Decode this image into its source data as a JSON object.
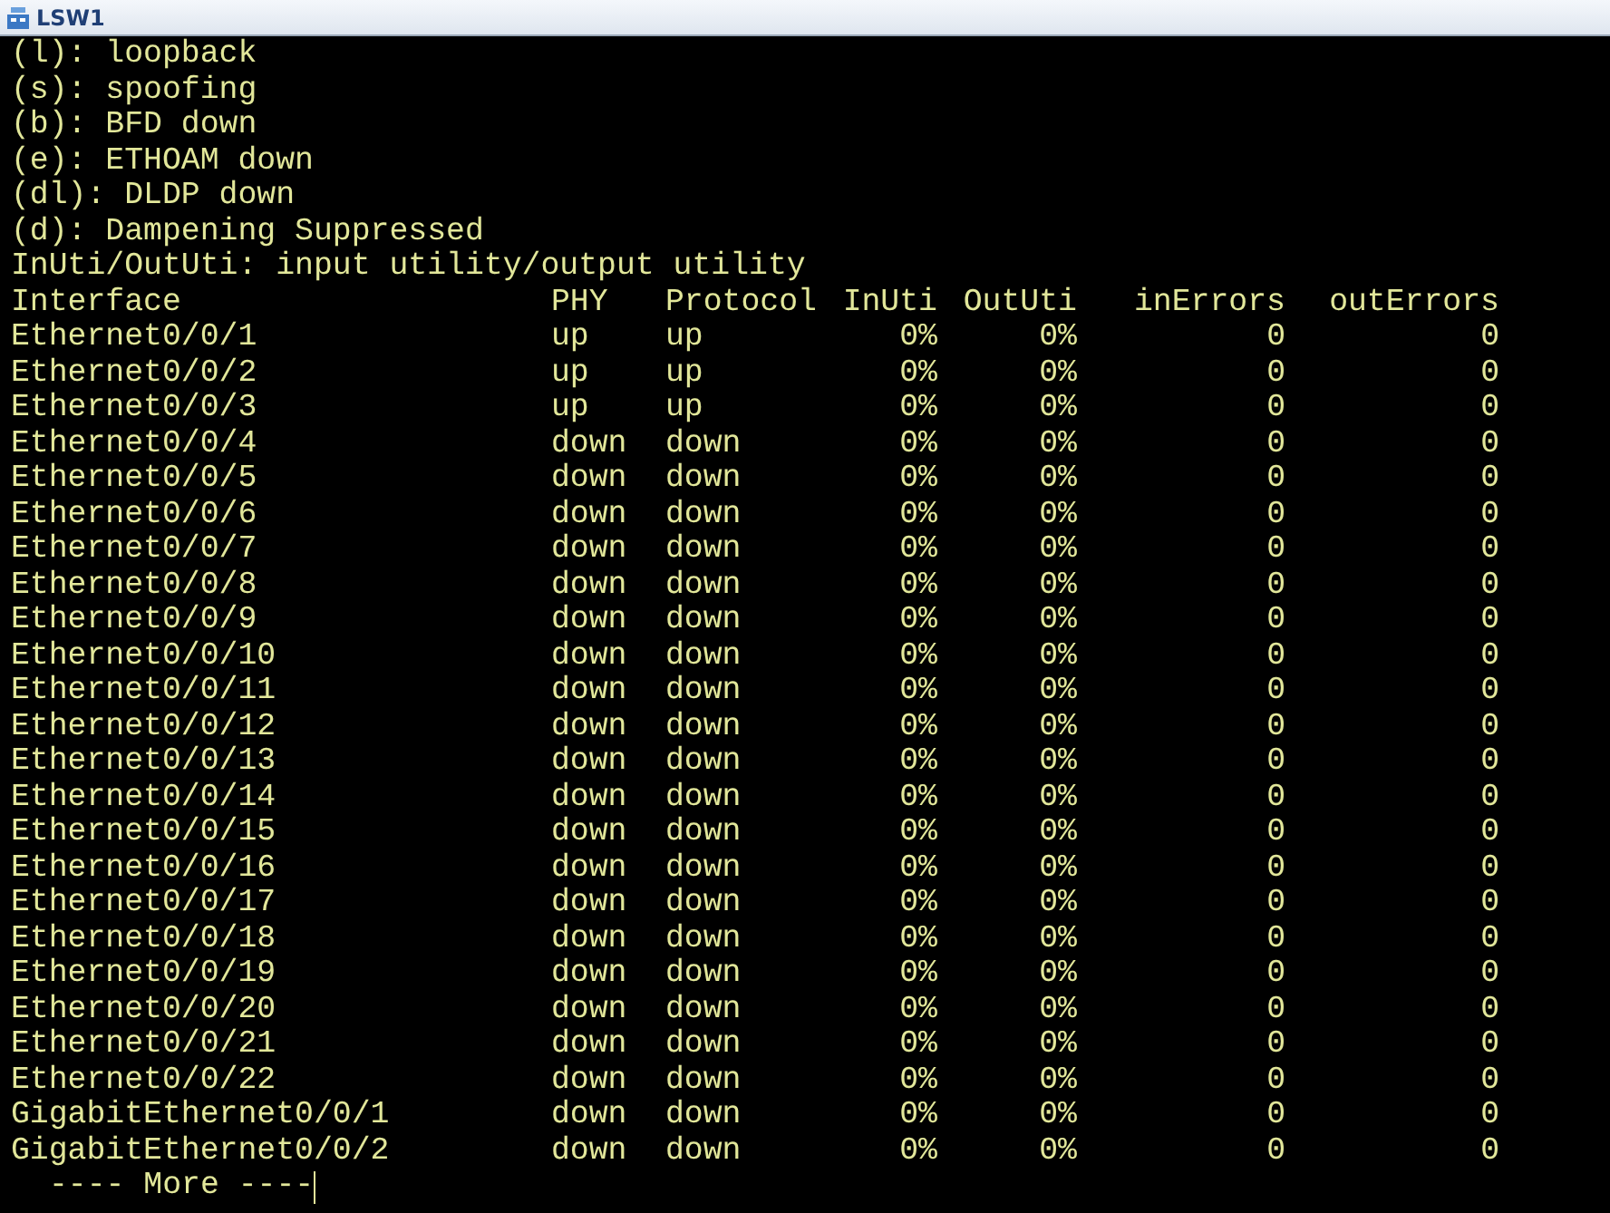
{
  "window": {
    "title": "LSW1"
  },
  "legend": [
    "(l): loopback",
    "(s): spoofing",
    "(b): BFD down",
    "(e): ETHOAM down",
    "(dl): DLDP down",
    "(d): Dampening Suppressed",
    "InUti/OutUti: input utility/output utility"
  ],
  "table": {
    "columns": [
      "Interface",
      "PHY",
      "Protocol",
      "InUti",
      "OutUti",
      "inErrors",
      "outErrors"
    ],
    "rows": [
      [
        "Ethernet0/0/1",
        "up",
        "up",
        "0%",
        "0%",
        "0",
        "0"
      ],
      [
        "Ethernet0/0/2",
        "up",
        "up",
        "0%",
        "0%",
        "0",
        "0"
      ],
      [
        "Ethernet0/0/3",
        "up",
        "up",
        "0%",
        "0%",
        "0",
        "0"
      ],
      [
        "Ethernet0/0/4",
        "down",
        "down",
        "0%",
        "0%",
        "0",
        "0"
      ],
      [
        "Ethernet0/0/5",
        "down",
        "down",
        "0%",
        "0%",
        "0",
        "0"
      ],
      [
        "Ethernet0/0/6",
        "down",
        "down",
        "0%",
        "0%",
        "0",
        "0"
      ],
      [
        "Ethernet0/0/7",
        "down",
        "down",
        "0%",
        "0%",
        "0",
        "0"
      ],
      [
        "Ethernet0/0/8",
        "down",
        "down",
        "0%",
        "0%",
        "0",
        "0"
      ],
      [
        "Ethernet0/0/9",
        "down",
        "down",
        "0%",
        "0%",
        "0",
        "0"
      ],
      [
        "Ethernet0/0/10",
        "down",
        "down",
        "0%",
        "0%",
        "0",
        "0"
      ],
      [
        "Ethernet0/0/11",
        "down",
        "down",
        "0%",
        "0%",
        "0",
        "0"
      ],
      [
        "Ethernet0/0/12",
        "down",
        "down",
        "0%",
        "0%",
        "0",
        "0"
      ],
      [
        "Ethernet0/0/13",
        "down",
        "down",
        "0%",
        "0%",
        "0",
        "0"
      ],
      [
        "Ethernet0/0/14",
        "down",
        "down",
        "0%",
        "0%",
        "0",
        "0"
      ],
      [
        "Ethernet0/0/15",
        "down",
        "down",
        "0%",
        "0%",
        "0",
        "0"
      ],
      [
        "Ethernet0/0/16",
        "down",
        "down",
        "0%",
        "0%",
        "0",
        "0"
      ],
      [
        "Ethernet0/0/17",
        "down",
        "down",
        "0%",
        "0%",
        "0",
        "0"
      ],
      [
        "Ethernet0/0/18",
        "down",
        "down",
        "0%",
        "0%",
        "0",
        "0"
      ],
      [
        "Ethernet0/0/19",
        "down",
        "down",
        "0%",
        "0%",
        "0",
        "0"
      ],
      [
        "Ethernet0/0/20",
        "down",
        "down",
        "0%",
        "0%",
        "0",
        "0"
      ],
      [
        "Ethernet0/0/21",
        "down",
        "down",
        "0%",
        "0%",
        "0",
        "0"
      ],
      [
        "Ethernet0/0/22",
        "down",
        "down",
        "0%",
        "0%",
        "0",
        "0"
      ],
      [
        "GigabitEthernet0/0/1",
        "down",
        "down",
        "0%",
        "0%",
        "0",
        "0"
      ],
      [
        "GigabitEthernet0/0/2",
        "down",
        "down",
        "0%",
        "0%",
        "0",
        "0"
      ]
    ]
  },
  "prompt": "---- More ----"
}
